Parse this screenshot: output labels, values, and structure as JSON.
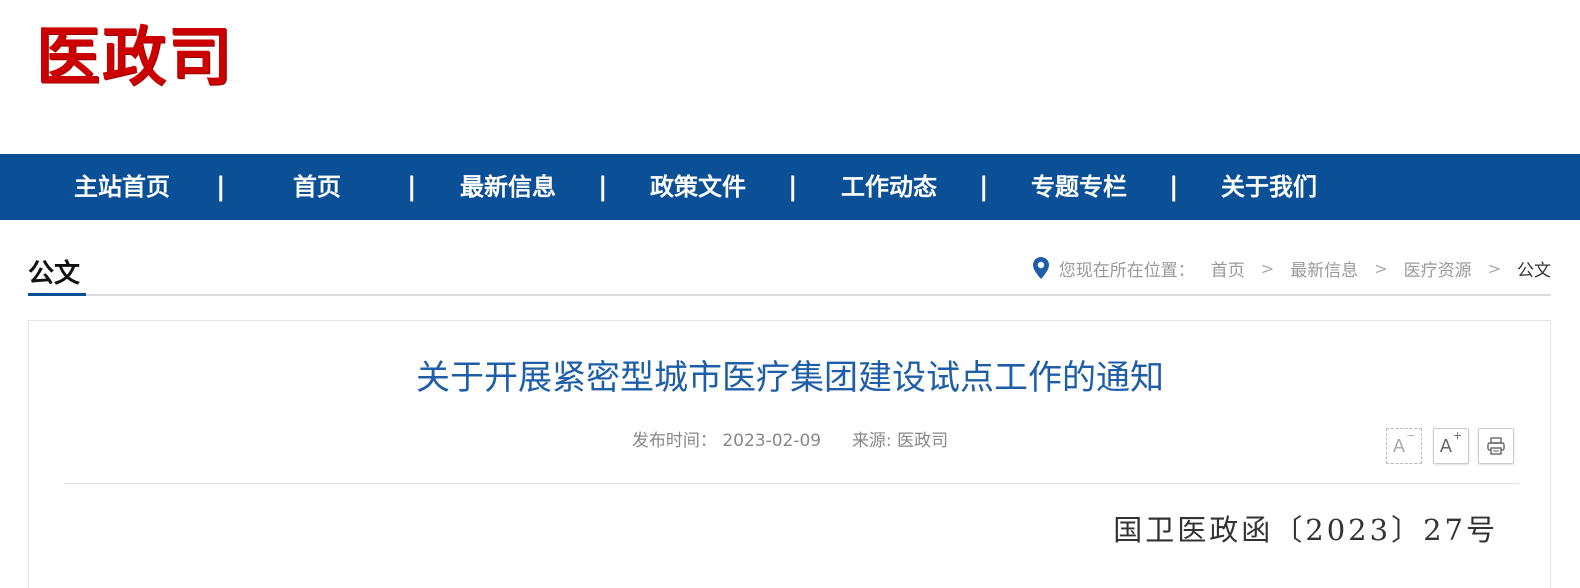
{
  "logo": {
    "text": "医政司"
  },
  "nav": {
    "items": [
      {
        "label": "主站首页"
      },
      {
        "label": "首页"
      },
      {
        "label": "最新信息"
      },
      {
        "label": "政策文件"
      },
      {
        "label": "工作动态"
      },
      {
        "label": "专题专栏"
      },
      {
        "label": "关于我们"
      }
    ],
    "separator": "|"
  },
  "section": {
    "title": "公文"
  },
  "breadcrumb": {
    "prefix": "您现在所在位置：",
    "items": [
      "首页",
      "最新信息",
      "医疗资源",
      "公文"
    ],
    "arrow": ">"
  },
  "article": {
    "title": "关于开展紧密型城市医疗集团建设试点工作的通知",
    "publish_label": "发布时间：",
    "publish_date": "2023-02-09",
    "source_label": "来源:",
    "source_value": "医政司",
    "doc_number": "国卫医政函〔2023〕27号"
  },
  "tools": {
    "font_decrease": "A",
    "font_decrease_mark": "−",
    "font_increase": "A",
    "font_increase_mark": "+"
  },
  "colors": {
    "nav_bg": "#0b4f96",
    "logo_red": "#cc0000",
    "title_blue": "#1e5ea8"
  }
}
